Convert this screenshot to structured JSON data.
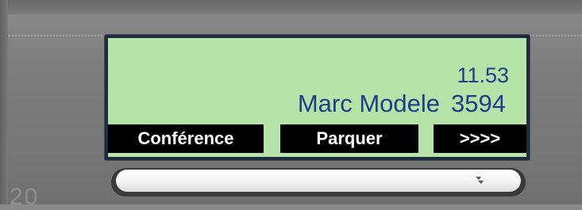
{
  "display": {
    "time": "11.53",
    "caller_name": "Marc Modele",
    "extension": "3594"
  },
  "softkeys": {
    "key1_label": "Conférence",
    "key2_label": "Parquer",
    "key3_label": ">>>>"
  },
  "panel": {
    "corner_digits": "20"
  },
  "colors": {
    "lcd_background": "#b5e3a8",
    "lcd_text": "#1f3d8a",
    "softkey_background": "#000000",
    "softkey_text": "#ffffff",
    "bezel": "#7d7d7d"
  },
  "icons": {
    "lower_button_icon": "chevron-down-icon"
  }
}
